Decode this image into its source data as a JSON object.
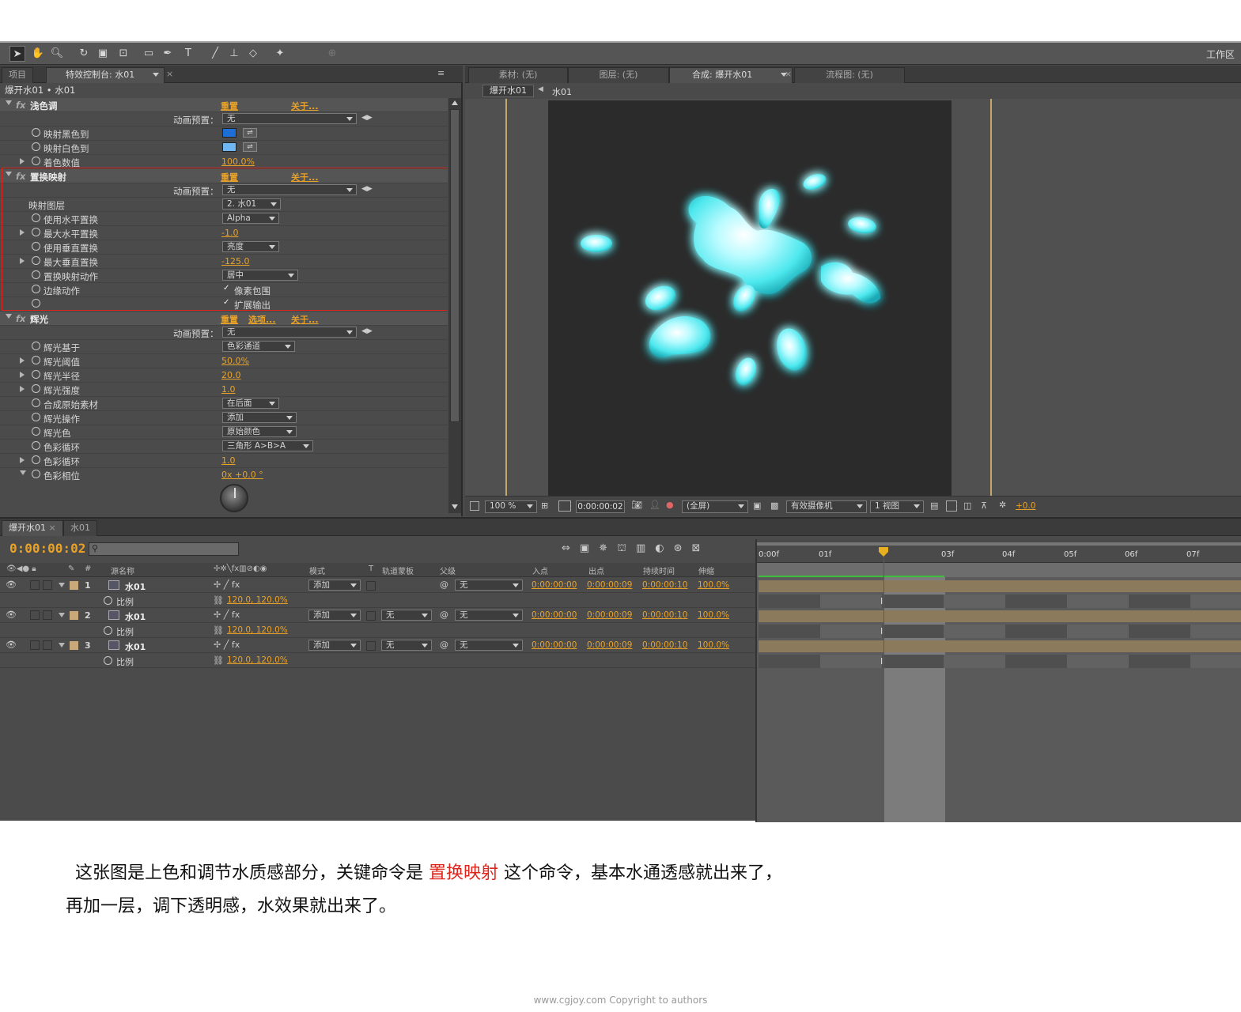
{
  "toolbar": {
    "workspace_label": "工作区"
  },
  "left_tabs": {
    "project": "项目",
    "effect_controls": "特效控制台: 水01"
  },
  "effect_breadcrumb": "爆开水01 • 水01",
  "effects": {
    "tint": {
      "name": "浅色调",
      "reset": "重置",
      "about": "关于...",
      "preset_label": "动画预置：",
      "preset_value": "无",
      "map_black": "映射黑色到",
      "map_white": "映射白色到",
      "amount": "着色数值",
      "amount_value": "100.0%",
      "black_color": "#1d6fd6",
      "white_color": "#6fb7f2"
    },
    "displace": {
      "name": "置换映射",
      "reset": "重置",
      "about": "关于...",
      "preset_label": "动画预置：",
      "preset_value": "无",
      "map_layer": "映射图层",
      "map_layer_value": "2. 水01",
      "use_h": "使用水平置换",
      "use_h_value": "Alpha",
      "max_h": "最大水平置换",
      "max_h_value": "-1.0",
      "use_v": "使用垂直置换",
      "use_v_value": "亮度",
      "max_v": "最大垂直置换",
      "max_v_value": "-125.0",
      "behavior": "置换映射动作",
      "behavior_value": "居中",
      "edge": "边缘动作",
      "wrap": "像素包围",
      "expand": "扩展输出"
    },
    "glow": {
      "name": "辉光",
      "reset": "重置",
      "options": "选项...",
      "about": "关于...",
      "preset_label": "动画预置：",
      "preset_value": "无",
      "based_on": "辉光基于",
      "based_on_value": "色彩通道",
      "threshold": "辉光阈值",
      "threshold_value": "50.0%",
      "radius": "辉光半径",
      "radius_value": "20.0",
      "intensity": "辉光强度",
      "intensity_value": "1.0",
      "composite": "合成原始素材",
      "composite_value": "在后面",
      "operation": "辉光操作",
      "operation_value": "添加",
      "colors": "辉光色",
      "colors_value": "原始颜色",
      "looping": "色彩循环",
      "looping_value": "三角形 A>B>A",
      "loops": "色彩循环",
      "loops_value": "1.0",
      "phase": "色彩相位",
      "phase_value": "0x +0.0 °"
    }
  },
  "viewer": {
    "tabs": {
      "footage": "素材: (无)",
      "layer": "图层: (无)",
      "comp": "合成: 爆开水01",
      "flow": "流程图: (无)"
    },
    "crumb_comp": "爆开水01",
    "crumb_layer": "水01",
    "zoom": "100 %",
    "time": "0:00:00:02",
    "resolution": "(全屏)",
    "camera": "有效摄像机",
    "views": "1 视图",
    "exposure": "+0.0"
  },
  "timeline": {
    "tabs": [
      "爆开水01",
      "水01"
    ],
    "current_time": "0:00:00:02",
    "headers": {
      "source": "源名称",
      "mode": "模式",
      "t": "T",
      "trkmat": "轨道蒙板",
      "parent": "父级",
      "in": "入点",
      "out": "出点",
      "duration": "持续时间",
      "stretch": "伸缩"
    },
    "ruler": [
      "0:00f",
      "01f",
      "03f",
      "04f",
      "05f",
      "06f",
      "07f"
    ],
    "layers": [
      {
        "num": "1",
        "name": "水01",
        "mode": "添加",
        "trkmat": "",
        "parent": "无",
        "in": "0:00:00:00",
        "out": "0:00:00:09",
        "duration": "0:00:00:10",
        "stretch": "100.0%",
        "prop": "比例",
        "scale": "120.0, 120.0%"
      },
      {
        "num": "2",
        "name": "水01",
        "mode": "添加",
        "trkmat": "无",
        "parent": "无",
        "in": "0:00:00:00",
        "out": "0:00:00:09",
        "duration": "0:00:00:10",
        "stretch": "100.0%",
        "prop": "比例",
        "scale": "120.0, 120.0%"
      },
      {
        "num": "3",
        "name": "水01",
        "mode": "添加",
        "trkmat": "无",
        "parent": "无",
        "in": "0:00:00:00",
        "out": "0:00:00:09",
        "duration": "0:00:00:10",
        "stretch": "100.0%",
        "prop": "比例",
        "scale": "120.0, 120.0%"
      }
    ]
  },
  "caption": {
    "line1_a": "这张图是上色和调节水质感部分，关键命令是",
    "line1_hl": "置换映射",
    "line1_b": "这个命令，基本水通透感就出来了，",
    "line2": "再加一层，调下透明感，水效果就出来了。"
  },
  "footer": "www.cgjoy.com  Copyright to authors",
  "colors": {
    "accent_orange": "#e8a22a",
    "highlight_red": "#e0251d",
    "water_cyan": "#5ff0f2",
    "layer_bar": "#8c7a5c"
  }
}
